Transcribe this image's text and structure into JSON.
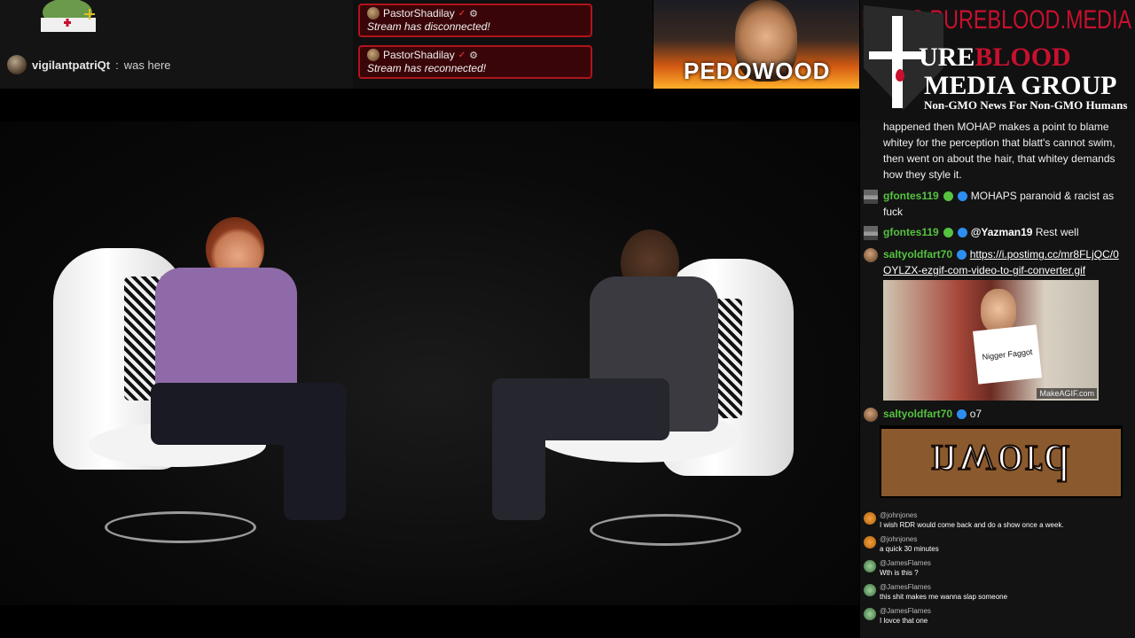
{
  "top_chat": {
    "username": "vigilantpatriQt",
    "separator": ":",
    "message": "was here"
  },
  "status_boxes": [
    {
      "user": "PastorShadilay",
      "verified_mark": "✓",
      "text": "Stream has disconnected!"
    },
    {
      "user": "PastorShadilay",
      "verified_mark": "✓",
      "text": "Stream has reconnected!"
    }
  ],
  "thumbnail": {
    "text": "PEDOWOOD"
  },
  "logo": {
    "url": "NEWS.PUREBLOOD.MEDIA",
    "title_white": "URE",
    "title_red": "BLOOD",
    "title_line2": "MEDIA GROUP",
    "tagline": "Non-GMO News For Non-GMO Humans"
  },
  "chat": {
    "messages": [
      {
        "user": "",
        "text": "happened then MOHAP makes a point to blame whitey for the perception that blatt's cannot swim, then went on about the hair, that whitey demands how they style it."
      },
      {
        "user": "gfontes119",
        "text": "MOHAPS paranoid & racist as fuck"
      },
      {
        "user": "gfontes119",
        "mention": "@Yazman19",
        "text": "Rest well"
      },
      {
        "user": "saltyoldfart70",
        "link": "https://i.postimg.cc/mr8FLjQC/0OYLZX-ezgif-com-video-to-gif-converter.gif"
      },
      {
        "user": "saltyoldfart70",
        "text": "o7"
      }
    ],
    "gif_sign_text": "Nigger Faggot",
    "gif_watermark": "MakeAGIF.com",
    "nword_text": "nword",
    "mini_messages": [
      {
        "name": "@johnjones",
        "text": "I wish RDR would come back and do a show once a week."
      },
      {
        "name": "@johnjones",
        "text": "a quick 30 minutes"
      },
      {
        "name": "@JamesFlames",
        "text": "Wth is this ?"
      },
      {
        "name": "@JamesFlames",
        "text": "this shit makes me wanna slap someone"
      },
      {
        "name": "@JamesFlames",
        "text": "I lovce that one"
      }
    ]
  },
  "icons": [
    "gear-icon",
    "verified-icon",
    "avatar"
  ]
}
